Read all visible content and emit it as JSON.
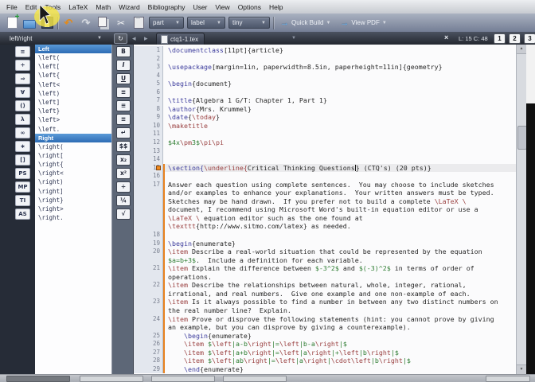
{
  "menu": {
    "items": [
      "File",
      "Edit",
      "Tools",
      "LaTeX",
      "Math",
      "Wizard",
      "Bibliography",
      "User",
      "View",
      "Options",
      "Help"
    ]
  },
  "toolbar": {
    "sectioning_combo": "part",
    "reference_combo": "label",
    "size_combo": "tiny",
    "quick_build_label": "Quick Build",
    "view_pdf_label": "View PDF"
  },
  "tabbar": {
    "panel_selector": "left/right",
    "document_tab": "ctq1-1.tex",
    "cursor_position": "L: 15 C: 48",
    "bookmark_buttons": [
      "1",
      "2",
      "3"
    ]
  },
  "sidebar": {
    "panel_icons": [
      {
        "glyph": "≡",
        "name": "structure-icon"
      },
      {
        "glyph": "÷",
        "name": "relation-symbols-icon"
      },
      {
        "glyph": "⇒",
        "name": "arrow-symbols-icon"
      },
      {
        "glyph": "∀",
        "name": "misc-symbols-icon"
      },
      {
        "glyph": "()",
        "name": "delimiters-icon"
      },
      {
        "glyph": "λ",
        "name": "greek-letters-icon"
      },
      {
        "glyph": "∞",
        "name": "most-used-symbols-icon"
      },
      {
        "glyph": "∗",
        "name": "favourite-symbols-icon"
      },
      {
        "glyph": "[]",
        "name": "left-right-brackets-icon"
      },
      {
        "glyph": "PS",
        "name": "pstricks-icon"
      },
      {
        "glyph": "MP",
        "name": "metapost-icon"
      },
      {
        "glyph": "TI",
        "name": "tikz-icon"
      },
      {
        "glyph": "AS",
        "name": "asymptote-icon"
      }
    ],
    "sections": [
      {
        "header": "Left",
        "items": [
          "\\left(",
          "\\left[",
          "\\left{",
          "\\left<",
          "\\left)",
          "\\left]",
          "\\left}",
          "\\left>",
          "\\left."
        ]
      },
      {
        "header": "Right",
        "items": [
          "\\right(",
          "\\right[",
          "\\right{",
          "\\right<",
          "\\right)",
          "\\right]",
          "\\right}",
          "\\right>",
          "\\right."
        ]
      }
    ]
  },
  "format_bar": [
    {
      "glyph": "B",
      "name": "bold-icon"
    },
    {
      "glyph": "I",
      "name": "italic-icon"
    },
    {
      "glyph": "U",
      "name": "underline-icon"
    },
    {
      "glyph": "≡",
      "name": "align-left-icon"
    },
    {
      "glyph": "≡",
      "name": "align-center-icon"
    },
    {
      "glyph": "≡",
      "name": "align-right-icon"
    },
    {
      "glyph": "↵",
      "name": "line-break-icon"
    },
    {
      "glyph": "$$",
      "name": "inline-math-icon"
    },
    {
      "glyph": "x₂",
      "name": "subscript-icon"
    },
    {
      "glyph": "x²",
      "name": "superscript-icon"
    },
    {
      "glyph": "÷",
      "name": "frac-icon"
    },
    {
      "glyph": "¼",
      "name": "dfrac-icon"
    },
    {
      "glyph": "√",
      "name": "sqrt-icon"
    }
  ],
  "editor": {
    "rows": [
      {
        "n": "1",
        "segs": [
          [
            "k",
            "\\documentclass"
          ],
          [
            "p",
            "[11pt]{article}"
          ]
        ]
      },
      {
        "n": "2",
        "segs": []
      },
      {
        "n": "3",
        "segs": [
          [
            "k",
            "\\usepackage"
          ],
          [
            "p",
            "[margin=1in, paperwidth=8.5in, paperheight=11in]{geometry}"
          ]
        ]
      },
      {
        "n": "4",
        "segs": []
      },
      {
        "n": "5",
        "segs": [
          [
            "k",
            "\\begin"
          ],
          [
            "p",
            "{document}"
          ]
        ]
      },
      {
        "n": "6",
        "segs": []
      },
      {
        "n": "7",
        "segs": [
          [
            "k",
            "\\title"
          ],
          [
            "p",
            "{Algebra 1 G/T: Chapter 1, Part 1}"
          ]
        ]
      },
      {
        "n": "8",
        "segs": [
          [
            "k",
            "\\author"
          ],
          [
            "p",
            "{Mrs. Krummel}"
          ]
        ]
      },
      {
        "n": "9",
        "segs": [
          [
            "k",
            "\\date"
          ],
          [
            "p",
            "{"
          ],
          [
            "c",
            "\\today"
          ],
          [
            "p",
            "}"
          ]
        ]
      },
      {
        "n": "10",
        "segs": [
          [
            "c",
            "\\maketitle"
          ]
        ]
      },
      {
        "n": "11",
        "segs": []
      },
      {
        "n": "12",
        "segs": [
          [
            "m",
            "$4x"
          ],
          [
            "c",
            "\\pm"
          ],
          [
            "m",
            "3$"
          ],
          [
            "c",
            "\\pi\\pi"
          ]
        ]
      },
      {
        "n": "13",
        "segs": []
      },
      {
        "n": "14",
        "segs": []
      },
      {
        "n": "15",
        "hl": true,
        "mark": true,
        "bar": true,
        "segs": [
          [
            "k",
            "\\section{"
          ],
          [
            "c",
            "\\underline{"
          ],
          [
            "p",
            "Critical Thinking Questions"
          ],
          [
            "cursor",
            ""
          ],
          [
            "p",
            "} (CTQ's) (20 pts)}"
          ]
        ]
      },
      {
        "n": "16",
        "bar": true,
        "segs": []
      },
      {
        "n": "17",
        "bar": true,
        "segs": [
          [
            "p",
            "Answer each question using complete sentences.  You may choose to include sketches"
          ]
        ]
      },
      {
        "n": "",
        "bar": true,
        "segs": [
          [
            "p",
            "and/or examples to enhance your explanations.  Your written answers must be typed."
          ]
        ]
      },
      {
        "n": "",
        "bar": true,
        "segs": [
          [
            "p",
            "Sketches may be hand drawn.  If you prefer not to build a complete "
          ],
          [
            "c",
            "\\LaTeX \\"
          ]
        ]
      },
      {
        "n": "",
        "bar": true,
        "segs": [
          [
            "p",
            "document, I recommend using Microsoft Word's built-in equation editor or use a"
          ]
        ]
      },
      {
        "n": "",
        "bar": true,
        "segs": [
          [
            "c",
            "\\LaTeX \\"
          ],
          [
            "p",
            " equation editor such as the one found at"
          ]
        ]
      },
      {
        "n": "",
        "bar": true,
        "segs": [
          [
            "c",
            "\\texttt"
          ],
          [
            "p",
            "{http://www.sitmo.com/latex} as needed."
          ]
        ]
      },
      {
        "n": "18",
        "bar": true,
        "segs": []
      },
      {
        "n": "19",
        "bar": true,
        "segs": [
          [
            "k",
            "\\begin"
          ],
          [
            "p",
            "{enumerate}"
          ]
        ]
      },
      {
        "n": "20",
        "bar": true,
        "segs": [
          [
            "c",
            "\\item"
          ],
          [
            "p",
            " Describe a real-world situation that could be represented by the equation"
          ]
        ]
      },
      {
        "n": "",
        "bar": true,
        "segs": [
          [
            "m",
            "$a=b+3$"
          ],
          [
            "p",
            ".  Include a definition for each variable."
          ]
        ]
      },
      {
        "n": "21",
        "bar": true,
        "segs": [
          [
            "c",
            "\\item"
          ],
          [
            "p",
            " Explain the difference between "
          ],
          [
            "m",
            "$-3^2$"
          ],
          [
            "p",
            " and "
          ],
          [
            "m",
            "$(-3)^2$"
          ],
          [
            "p",
            " in terms of order of"
          ]
        ]
      },
      {
        "n": "",
        "bar": true,
        "segs": [
          [
            "p",
            "operations."
          ]
        ]
      },
      {
        "n": "22",
        "bar": true,
        "segs": [
          [
            "c",
            "\\item"
          ],
          [
            "p",
            " Describe the relationships between natural, whole, integer, rational,"
          ]
        ]
      },
      {
        "n": "",
        "bar": true,
        "segs": [
          [
            "p",
            "irrational, and real numbers.  Give one example and one non-example of each."
          ]
        ]
      },
      {
        "n": "23",
        "bar": true,
        "segs": [
          [
            "c",
            "\\item"
          ],
          [
            "p",
            " Is it always possible to find a number in between any two distinct numbers on"
          ]
        ]
      },
      {
        "n": "",
        "bar": true,
        "segs": [
          [
            "p",
            "the real number line?  Explain."
          ]
        ]
      },
      {
        "n": "24",
        "bar": true,
        "segs": [
          [
            "c",
            "\\item"
          ],
          [
            "p",
            " Prove or disprove the following statements (hint: you cannot prove by giving"
          ]
        ]
      },
      {
        "n": "",
        "bar": true,
        "segs": [
          [
            "p",
            "an example, but you can disprove by giving a counterexample)."
          ]
        ]
      },
      {
        "n": "25",
        "bar": true,
        "segs": [
          [
            "p",
            "    "
          ],
          [
            "k",
            "\\begin"
          ],
          [
            "p",
            "{enumerate}"
          ]
        ]
      },
      {
        "n": "26",
        "bar": true,
        "segs": [
          [
            "p",
            "    "
          ],
          [
            "c",
            "\\item"
          ],
          [
            "p",
            " "
          ],
          [
            "m",
            "$"
          ],
          [
            "c",
            "\\left"
          ],
          [
            "m",
            "|a-b"
          ],
          [
            "c",
            "\\right"
          ],
          [
            "m",
            "|="
          ],
          [
            "c",
            "\\left"
          ],
          [
            "m",
            "|b-a"
          ],
          [
            "c",
            "\\right"
          ],
          [
            "m",
            "|$"
          ]
        ]
      },
      {
        "n": "27",
        "bar": true,
        "segs": [
          [
            "p",
            "    "
          ],
          [
            "c",
            "\\item"
          ],
          [
            "p",
            " "
          ],
          [
            "m",
            "$"
          ],
          [
            "c",
            "\\left"
          ],
          [
            "m",
            "|a+b"
          ],
          [
            "c",
            "\\right"
          ],
          [
            "m",
            "|="
          ],
          [
            "c",
            "\\left"
          ],
          [
            "m",
            "|a"
          ],
          [
            "c",
            "\\right"
          ],
          [
            "m",
            "|+"
          ],
          [
            "c",
            "\\left"
          ],
          [
            "m",
            "|b"
          ],
          [
            "c",
            "\\right"
          ],
          [
            "m",
            "|$"
          ]
        ]
      },
      {
        "n": "28",
        "bar": true,
        "segs": [
          [
            "p",
            "    "
          ],
          [
            "c",
            "\\item"
          ],
          [
            "p",
            " "
          ],
          [
            "m",
            "$"
          ],
          [
            "c",
            "\\left"
          ],
          [
            "m",
            "|ab"
          ],
          [
            "c",
            "\\right"
          ],
          [
            "m",
            "|="
          ],
          [
            "c",
            "\\left"
          ],
          [
            "m",
            "|a"
          ],
          [
            "c",
            "\\right"
          ],
          [
            "m",
            "|"
          ],
          [
            "c",
            "\\cdot"
          ],
          [
            "c",
            "\\left"
          ],
          [
            "m",
            "|b"
          ],
          [
            "c",
            "\\right"
          ],
          [
            "m",
            "|$"
          ]
        ]
      },
      {
        "n": "29",
        "bar": true,
        "segs": [
          [
            "p",
            "    "
          ],
          [
            "k",
            "\\end"
          ],
          [
            "p",
            "{enumerate}"
          ]
        ]
      }
    ]
  },
  "colors": {
    "keyword": "#3b3b9c",
    "command": "#9a4040",
    "math": "#2e7d32",
    "section_header_bg": "#2d6cb4",
    "change_marker": "#e8821e",
    "cursor_highlight": "#f4e446"
  },
  "taskbar": {
    "buttons": [
      {
        "active": true
      },
      {
        "active": false
      },
      {
        "active": false
      },
      {
        "active": false
      }
    ]
  }
}
